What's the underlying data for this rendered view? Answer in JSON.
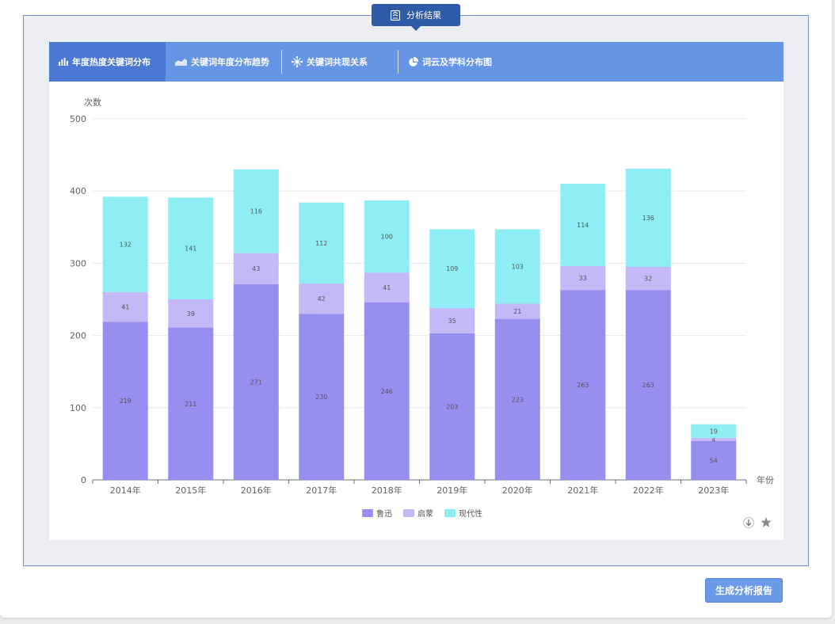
{
  "header": {
    "badge_label": "分析结果"
  },
  "tabs": [
    {
      "label": "年度热度关键词分布",
      "icon": "bar-chart-icon",
      "active": true
    },
    {
      "label": "关键词年度分布趋势",
      "icon": "area-chart-icon",
      "active": false
    },
    {
      "label": "关键词共现关系",
      "icon": "network-icon",
      "active": false
    },
    {
      "label": "词云及学科分布图",
      "icon": "pie-chart-icon",
      "active": false
    }
  ],
  "footer": {
    "report_button": "生成分析报告"
  },
  "toolbox": {
    "download_icon": "download-icon",
    "favorite_icon": "star-icon"
  },
  "colors": {
    "primary": "#6695e6",
    "active_tab": "#4b78d2",
    "badge": "#2f5aa8"
  },
  "chart_data": {
    "type": "bar",
    "stacked": true,
    "categories": [
      "2014年",
      "2015年",
      "2016年",
      "2017年",
      "2018年",
      "2019年",
      "2020年",
      "2021年",
      "2022年",
      "2023年"
    ],
    "series": [
      {
        "name": "鲁迅",
        "color": "#968ff0",
        "values": [
          219,
          211,
          271,
          230,
          246,
          203,
          223,
          263,
          263,
          54
        ]
      },
      {
        "name": "启蒙",
        "color": "#c3b9f6",
        "values": [
          41,
          39,
          43,
          42,
          41,
          35,
          21,
          33,
          32,
          4
        ]
      },
      {
        "name": "现代性",
        "color": "#8eeef3",
        "values": [
          132,
          141,
          116,
          112,
          100,
          109,
          103,
          114,
          136,
          19
        ]
      }
    ],
    "xlabel": "年份",
    "ylabel": "次数",
    "ylim": [
      0,
      500
    ],
    "yticks": [
      0,
      100,
      200,
      300,
      400,
      500
    ],
    "grid": true,
    "legend": "bottom-center"
  }
}
